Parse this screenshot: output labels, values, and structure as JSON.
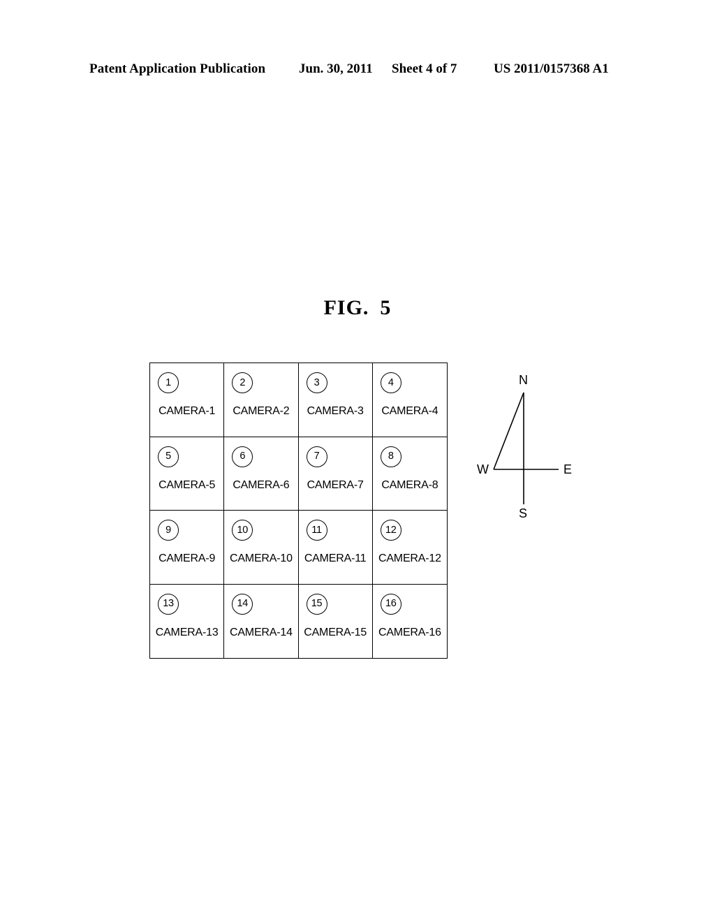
{
  "header": {
    "publication": "Patent Application Publication",
    "date": "Jun. 30, 2011",
    "sheet": "Sheet 4 of 7",
    "patent_number": "US 2011/0157368 A1"
  },
  "figure": {
    "label": "FIG.",
    "number": "5"
  },
  "grid": {
    "rows": 4,
    "columns": 4,
    "cells": [
      {
        "number": "1",
        "label": "CAMERA-1"
      },
      {
        "number": "2",
        "label": "CAMERA-2"
      },
      {
        "number": "3",
        "label": "CAMERA-3"
      },
      {
        "number": "4",
        "label": "CAMERA-4"
      },
      {
        "number": "5",
        "label": "CAMERA-5"
      },
      {
        "number": "6",
        "label": "CAMERA-6"
      },
      {
        "number": "7",
        "label": "CAMERA-7"
      },
      {
        "number": "8",
        "label": "CAMERA-8"
      },
      {
        "number": "9",
        "label": "CAMERA-9"
      },
      {
        "number": "10",
        "label": "CAMERA-10"
      },
      {
        "number": "11",
        "label": "CAMERA-11"
      },
      {
        "number": "12",
        "label": "CAMERA-12"
      },
      {
        "number": "13",
        "label": "CAMERA-13"
      },
      {
        "number": "14",
        "label": "CAMERA-14"
      },
      {
        "number": "15",
        "label": "CAMERA-15"
      },
      {
        "number": "16",
        "label": "CAMERA-16"
      }
    ]
  },
  "compass": {
    "north": "N",
    "south": "S",
    "west": "W",
    "east": "E"
  },
  "colors": {
    "ink": "#000000",
    "paper": "#ffffff"
  }
}
